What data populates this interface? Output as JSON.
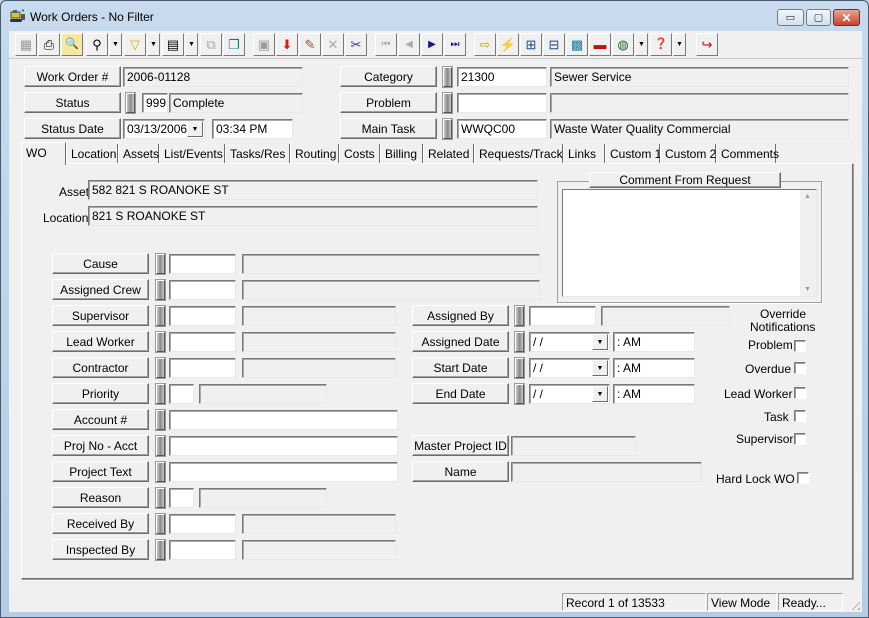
{
  "window": {
    "title": "Work Orders - No Filter",
    "controls": {
      "minimize": "▭",
      "maximize": "▢",
      "close": "✕"
    }
  },
  "toolbar": {
    "buttons": [
      {
        "name": "screen-icon",
        "glyph": "▦"
      },
      {
        "name": "print-icon",
        "glyph": "⎙"
      },
      {
        "name": "preview-icon",
        "glyph": "🔍"
      },
      {
        "name": "find-icon",
        "glyph": "⚲"
      },
      {
        "name": "filter-icon",
        "glyph": "▽"
      },
      {
        "name": "report-icon",
        "glyph": "▤"
      },
      {
        "name": "properties-icon",
        "glyph": "⧉"
      },
      {
        "name": "copy-record-icon",
        "glyph": "❐"
      },
      {
        "name": "save-icon",
        "glyph": "▣"
      },
      {
        "name": "new-record-icon",
        "glyph": "⬇"
      },
      {
        "name": "edit-icon",
        "glyph": "✎"
      },
      {
        "name": "delete-icon",
        "glyph": "✕"
      },
      {
        "name": "cut-icon",
        "glyph": "✂"
      },
      {
        "name": "first-record-icon",
        "glyph": "⏮"
      },
      {
        "name": "previous-record-icon",
        "glyph": "◀"
      },
      {
        "name": "next-record-icon",
        "glyph": "▶"
      },
      {
        "name": "last-record-icon",
        "glyph": "⏭"
      },
      {
        "name": "go-to-icon",
        "glyph": "⇨"
      },
      {
        "name": "quick-action-icon",
        "glyph": "⚡"
      },
      {
        "name": "structure-icon",
        "glyph": "⊞"
      },
      {
        "name": "flow-icon",
        "glyph": "⊟"
      },
      {
        "name": "equipment-icon",
        "glyph": "▩"
      },
      {
        "name": "toolbox-icon",
        "glyph": "▬"
      },
      {
        "name": "map-globe-icon",
        "glyph": "◍"
      },
      {
        "name": "help-book-icon",
        "glyph": "❓"
      },
      {
        "name": "exit-icon",
        "glyph": "↪"
      }
    ],
    "dropdown_glyph": "▼"
  },
  "header": {
    "work_order": {
      "label": "Work Order #",
      "value": "2006-01128"
    },
    "status": {
      "label": "Status",
      "code": "999",
      "description": "Complete"
    },
    "status_date": {
      "label": "Status Date",
      "date": "03/13/2006",
      "time": "03:34 PM"
    },
    "category": {
      "label": "Category",
      "code": "21300",
      "description": "Sewer Service"
    },
    "problem": {
      "label": "Problem",
      "code": "",
      "description": ""
    },
    "main_task": {
      "label": "Main Task",
      "code": "WWQC00",
      "description": "Waste Water Quality Commercial"
    }
  },
  "tabs": [
    {
      "label": "WO",
      "active": true
    },
    {
      "label": "Location"
    },
    {
      "label": "Assets"
    },
    {
      "label": "List/Events"
    },
    {
      "label": "Tasks/Res"
    },
    {
      "label": "Routing"
    },
    {
      "label": "Costs"
    },
    {
      "label": "Billing"
    },
    {
      "label": "Related"
    },
    {
      "label": "Requests/Track"
    },
    {
      "label": "Links"
    },
    {
      "label": "Custom 1"
    },
    {
      "label": "Custom 2"
    },
    {
      "label": "Comments"
    }
  ],
  "wo_tab": {
    "asset": {
      "label": "Asset",
      "value": "582 821 S ROANOKE ST"
    },
    "location": {
      "label": "Location",
      "value": "821 S ROANOKE ST"
    },
    "comment_from_request": {
      "label": "Comment From Request",
      "value": ""
    },
    "left_fields": [
      {
        "label": "Cause",
        "code": "",
        "description": ""
      },
      {
        "label": "Assigned Crew",
        "code": "",
        "description": ""
      },
      {
        "label": "Supervisor",
        "code": "",
        "description": ""
      },
      {
        "label": "Lead Worker",
        "code": "",
        "description": ""
      },
      {
        "label": "Contractor",
        "code": "",
        "description": ""
      },
      {
        "label": "Priority",
        "code": "",
        "description": ""
      },
      {
        "label": "Account #",
        "value": ""
      },
      {
        "label": "Proj No - Acct",
        "value": ""
      },
      {
        "label": "Project Text",
        "value": ""
      },
      {
        "label": "Reason",
        "code": "",
        "description": ""
      },
      {
        "label": "Received By",
        "code": "",
        "description": ""
      },
      {
        "label": "Inspected By",
        "code": "",
        "description": ""
      }
    ],
    "assigned_by": {
      "label": "Assigned By",
      "code": "",
      "description": ""
    },
    "dates": [
      {
        "label": "Assigned Date",
        "date": " /  /",
        "time": " :  AM"
      },
      {
        "label": "Start Date",
        "date": " /  /",
        "time": " :  AM"
      },
      {
        "label": "End Date",
        "date": " /  /",
        "time": " :  AM"
      }
    ],
    "master_project_id": {
      "label": "Master Project ID",
      "value": ""
    },
    "name": {
      "label": "Name",
      "value": ""
    },
    "override_notifications": {
      "title_line1": "Override",
      "title_line2": "Notifications",
      "options": [
        {
          "label": "Problem",
          "checked": false
        },
        {
          "label": "Overdue",
          "checked": false
        },
        {
          "label": "Lead Worker",
          "checked": false
        },
        {
          "label": "Task",
          "checked": false
        },
        {
          "label": "Supervisor",
          "checked": false
        }
      ]
    },
    "hard_lock": {
      "label": "Hard Lock WO",
      "checked": false
    }
  },
  "statusbar": {
    "record": "Record 1 of 13533",
    "mode": "View Mode",
    "state": "Ready..."
  }
}
